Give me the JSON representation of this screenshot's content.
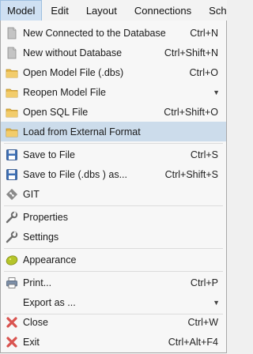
{
  "menubar": {
    "items": [
      "Model",
      "Edit",
      "Layout",
      "Connections",
      "Schema"
    ]
  },
  "menu": {
    "items": [
      {
        "label": "New Connected to the Database",
        "shortcut": "Ctrl+N",
        "icon": "document-icon"
      },
      {
        "label": "New without Database",
        "shortcut": "Ctrl+Shift+N",
        "icon": "document-icon"
      },
      {
        "label": "Open Model File (.dbs)",
        "shortcut": "Ctrl+O",
        "icon": "folder-icon"
      },
      {
        "label": "Reopen Model File",
        "shortcut": "",
        "icon": "folder-icon"
      },
      {
        "label": "Open SQL File",
        "shortcut": "Ctrl+Shift+O",
        "icon": "folder-icon"
      },
      {
        "label": "Load from External Format",
        "shortcut": "",
        "icon": "folder-icon"
      },
      {
        "label": "Save to File",
        "shortcut": "Ctrl+S",
        "icon": "floppy-icon"
      },
      {
        "label": "Save to File (.dbs ) as...",
        "shortcut": "Ctrl+Shift+S",
        "icon": "floppy-icon"
      },
      {
        "label": "GIT",
        "shortcut": "",
        "icon": "git-icon"
      },
      {
        "label": "Properties",
        "shortcut": "",
        "icon": "wrench-icon"
      },
      {
        "label": "Settings",
        "shortcut": "",
        "icon": "wrench-icon"
      },
      {
        "label": "Appearance",
        "shortcut": "",
        "icon": "palette-icon"
      },
      {
        "label": "Print...",
        "shortcut": "Ctrl+P",
        "icon": "printer-icon"
      },
      {
        "label": "Export as ...",
        "shortcut": "",
        "icon": ""
      },
      {
        "label": "Close",
        "shortcut": "Ctrl+W",
        "icon": "close-icon"
      },
      {
        "label": "Exit",
        "shortcut": "Ctrl+Alt+F4",
        "icon": "close-icon"
      }
    ],
    "highlighted_index": 5,
    "submenu_arrow": "▼"
  },
  "colors": {
    "highlight": "#ccdceb",
    "folder": "#e8b84a",
    "close": "#d9534f"
  }
}
